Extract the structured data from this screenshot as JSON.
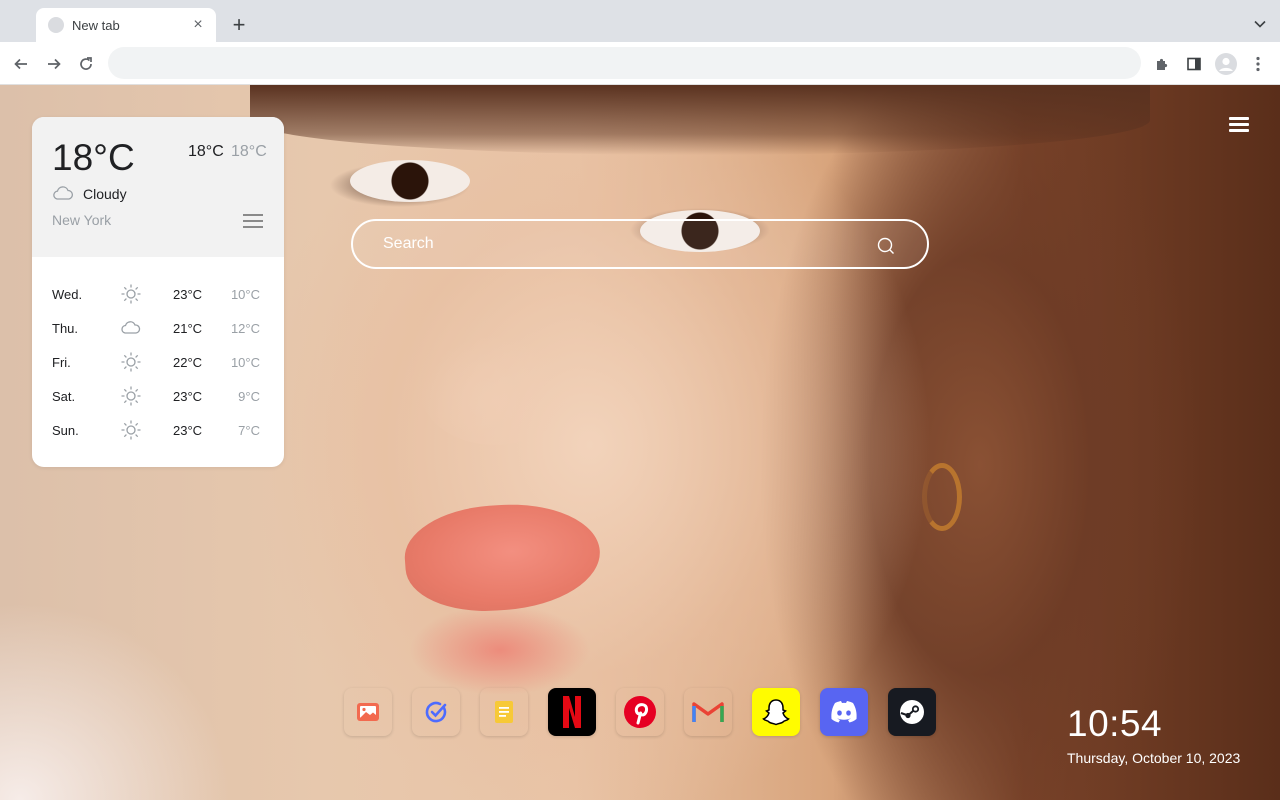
{
  "browser": {
    "tab_title": "New tab",
    "new_tab_symbol": "+",
    "close_symbol": "×",
    "address_value": ""
  },
  "weather": {
    "current_temp": "18°C",
    "high": "18°C",
    "low": "18°C",
    "condition": "Cloudy",
    "condition_icon": "cloud-icon",
    "city": "New York",
    "forecast": [
      {
        "day": "Wed.",
        "icon": "sun-icon",
        "high": "23°C",
        "low": "10°C"
      },
      {
        "day": "Thu.",
        "icon": "cloud-icon",
        "high": "21°C",
        "low": "12°C"
      },
      {
        "day": "Fri.",
        "icon": "sun-icon",
        "high": "22°C",
        "low": "10°C"
      },
      {
        "day": "Sat.",
        "icon": "sun-icon",
        "high": "23°C",
        "low": "9°C"
      },
      {
        "day": "Sun.",
        "icon": "sun-icon",
        "high": "23°C",
        "low": "7°C"
      }
    ]
  },
  "search": {
    "placeholder": "Search"
  },
  "dock": [
    {
      "name": "wallpaper-app",
      "icon": "image-icon",
      "bg": "#ffffff"
    },
    {
      "name": "tasks-app",
      "icon": "check-circle-icon",
      "bg": "#ffffff"
    },
    {
      "name": "notes-app",
      "icon": "note-icon",
      "bg": "#ffffff"
    },
    {
      "name": "netflix",
      "icon": "netflix-logo-icon",
      "bg": "#000000"
    },
    {
      "name": "pinterest",
      "icon": "pinterest-logo-icon",
      "bg": "#ffffff"
    },
    {
      "name": "gmail",
      "icon": "gmail-logo-icon",
      "bg": "#ffffff"
    },
    {
      "name": "snapchat",
      "icon": "snapchat-logo-icon",
      "bg": "#fffc00"
    },
    {
      "name": "discord",
      "icon": "discord-logo-icon",
      "bg": "#5865f2"
    },
    {
      "name": "steam",
      "icon": "steam-logo-icon",
      "bg": "#171a21"
    }
  ],
  "clock": {
    "time": "10:54",
    "date": "Thursday, October 10, 2023"
  }
}
